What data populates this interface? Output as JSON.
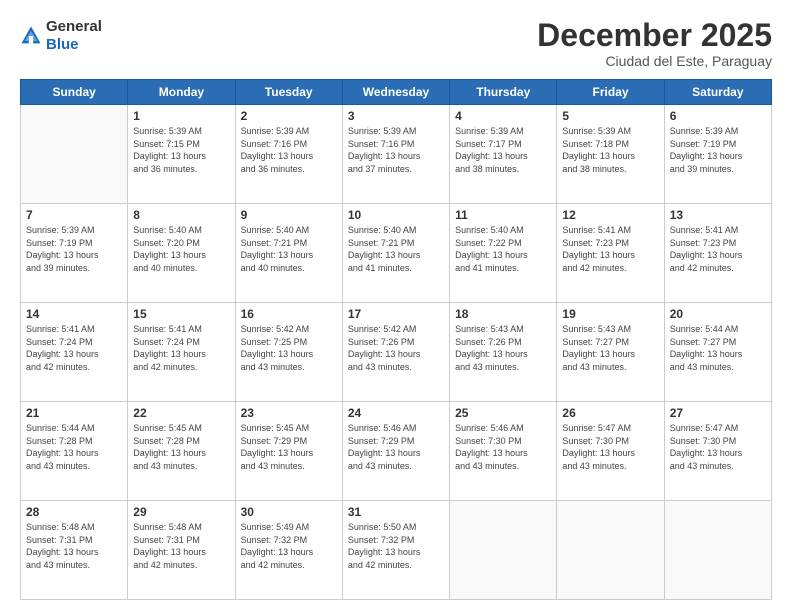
{
  "logo": {
    "general": "General",
    "blue": "Blue"
  },
  "header": {
    "month": "December 2025",
    "location": "Ciudad del Este, Paraguay"
  },
  "weekdays": [
    "Sunday",
    "Monday",
    "Tuesday",
    "Wednesday",
    "Thursday",
    "Friday",
    "Saturday"
  ],
  "weeks": [
    [
      {
        "day": "",
        "info": ""
      },
      {
        "day": "1",
        "info": "Sunrise: 5:39 AM\nSunset: 7:15 PM\nDaylight: 13 hours\nand 36 minutes."
      },
      {
        "day": "2",
        "info": "Sunrise: 5:39 AM\nSunset: 7:16 PM\nDaylight: 13 hours\nand 36 minutes."
      },
      {
        "day": "3",
        "info": "Sunrise: 5:39 AM\nSunset: 7:16 PM\nDaylight: 13 hours\nand 37 minutes."
      },
      {
        "day": "4",
        "info": "Sunrise: 5:39 AM\nSunset: 7:17 PM\nDaylight: 13 hours\nand 38 minutes."
      },
      {
        "day": "5",
        "info": "Sunrise: 5:39 AM\nSunset: 7:18 PM\nDaylight: 13 hours\nand 38 minutes."
      },
      {
        "day": "6",
        "info": "Sunrise: 5:39 AM\nSunset: 7:19 PM\nDaylight: 13 hours\nand 39 minutes."
      }
    ],
    [
      {
        "day": "7",
        "info": "Sunrise: 5:39 AM\nSunset: 7:19 PM\nDaylight: 13 hours\nand 39 minutes."
      },
      {
        "day": "8",
        "info": "Sunrise: 5:40 AM\nSunset: 7:20 PM\nDaylight: 13 hours\nand 40 minutes."
      },
      {
        "day": "9",
        "info": "Sunrise: 5:40 AM\nSunset: 7:21 PM\nDaylight: 13 hours\nand 40 minutes."
      },
      {
        "day": "10",
        "info": "Sunrise: 5:40 AM\nSunset: 7:21 PM\nDaylight: 13 hours\nand 41 minutes."
      },
      {
        "day": "11",
        "info": "Sunrise: 5:40 AM\nSunset: 7:22 PM\nDaylight: 13 hours\nand 41 minutes."
      },
      {
        "day": "12",
        "info": "Sunrise: 5:41 AM\nSunset: 7:23 PM\nDaylight: 13 hours\nand 42 minutes."
      },
      {
        "day": "13",
        "info": "Sunrise: 5:41 AM\nSunset: 7:23 PM\nDaylight: 13 hours\nand 42 minutes."
      }
    ],
    [
      {
        "day": "14",
        "info": "Sunrise: 5:41 AM\nSunset: 7:24 PM\nDaylight: 13 hours\nand 42 minutes."
      },
      {
        "day": "15",
        "info": "Sunrise: 5:41 AM\nSunset: 7:24 PM\nDaylight: 13 hours\nand 42 minutes."
      },
      {
        "day": "16",
        "info": "Sunrise: 5:42 AM\nSunset: 7:25 PM\nDaylight: 13 hours\nand 43 minutes."
      },
      {
        "day": "17",
        "info": "Sunrise: 5:42 AM\nSunset: 7:26 PM\nDaylight: 13 hours\nand 43 minutes."
      },
      {
        "day": "18",
        "info": "Sunrise: 5:43 AM\nSunset: 7:26 PM\nDaylight: 13 hours\nand 43 minutes."
      },
      {
        "day": "19",
        "info": "Sunrise: 5:43 AM\nSunset: 7:27 PM\nDaylight: 13 hours\nand 43 minutes."
      },
      {
        "day": "20",
        "info": "Sunrise: 5:44 AM\nSunset: 7:27 PM\nDaylight: 13 hours\nand 43 minutes."
      }
    ],
    [
      {
        "day": "21",
        "info": "Sunrise: 5:44 AM\nSunset: 7:28 PM\nDaylight: 13 hours\nand 43 minutes."
      },
      {
        "day": "22",
        "info": "Sunrise: 5:45 AM\nSunset: 7:28 PM\nDaylight: 13 hours\nand 43 minutes."
      },
      {
        "day": "23",
        "info": "Sunrise: 5:45 AM\nSunset: 7:29 PM\nDaylight: 13 hours\nand 43 minutes."
      },
      {
        "day": "24",
        "info": "Sunrise: 5:46 AM\nSunset: 7:29 PM\nDaylight: 13 hours\nand 43 minutes."
      },
      {
        "day": "25",
        "info": "Sunrise: 5:46 AM\nSunset: 7:30 PM\nDaylight: 13 hours\nand 43 minutes."
      },
      {
        "day": "26",
        "info": "Sunrise: 5:47 AM\nSunset: 7:30 PM\nDaylight: 13 hours\nand 43 minutes."
      },
      {
        "day": "27",
        "info": "Sunrise: 5:47 AM\nSunset: 7:30 PM\nDaylight: 13 hours\nand 43 minutes."
      }
    ],
    [
      {
        "day": "28",
        "info": "Sunrise: 5:48 AM\nSunset: 7:31 PM\nDaylight: 13 hours\nand 43 minutes."
      },
      {
        "day": "29",
        "info": "Sunrise: 5:48 AM\nSunset: 7:31 PM\nDaylight: 13 hours\nand 42 minutes."
      },
      {
        "day": "30",
        "info": "Sunrise: 5:49 AM\nSunset: 7:32 PM\nDaylight: 13 hours\nand 42 minutes."
      },
      {
        "day": "31",
        "info": "Sunrise: 5:50 AM\nSunset: 7:32 PM\nDaylight: 13 hours\nand 42 minutes."
      },
      {
        "day": "",
        "info": ""
      },
      {
        "day": "",
        "info": ""
      },
      {
        "day": "",
        "info": ""
      }
    ]
  ]
}
